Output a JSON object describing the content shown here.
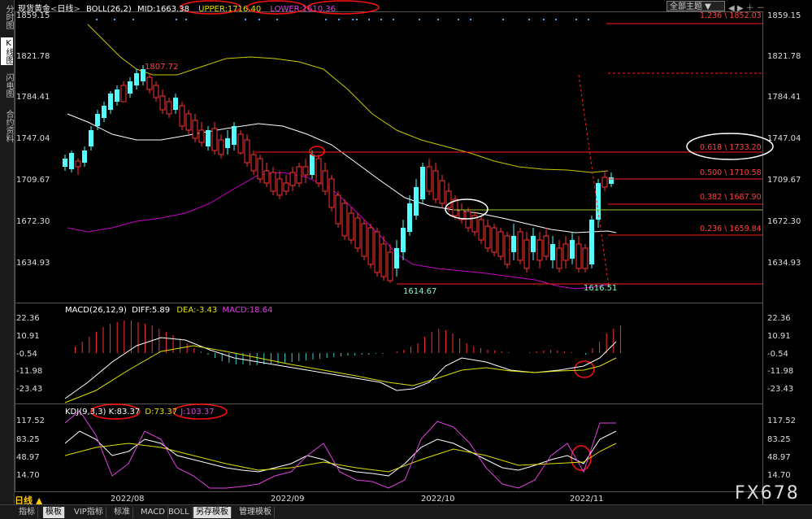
{
  "sidebar": {
    "tabs": [
      {
        "label": "分时图"
      },
      {
        "label": "K线图"
      },
      {
        "label": "闪电图"
      },
      {
        "label": "合约资料"
      }
    ]
  },
  "header": {
    "instrument": "现货黄金",
    "period": "日线",
    "boll_label": "BOLL(26,2)",
    "mid": "MID:1663.38",
    "upper": "UPPER:1716.40",
    "lower": "LOWER:1610.36",
    "theme_button": "全部主题"
  },
  "price_axis": [
    "1859.15",
    "1821.78",
    "1784.41",
    "1747.04",
    "1709.67",
    "1672.30",
    "1634.93"
  ],
  "annotations": {
    "high": "1807.72",
    "low1": "1614.67",
    "low2": "1616.51"
  },
  "fib_levels": [
    {
      "label": "1.236 \\ 1852.03"
    },
    {
      "label": "0.618 \\ 1733.20"
    },
    {
      "label": "0.500 \\ 1710.58"
    },
    {
      "label": "0.382 \\ 1687.90"
    },
    {
      "label": "0.236 \\ 1659.84"
    }
  ],
  "macd": {
    "label": "MACD(26,12,9)",
    "diff": "DIFF:5.89",
    "dea": "DEA:-3.43",
    "macd": "MACD:18.64",
    "axis": [
      "22.36",
      "10.91",
      "-0.54",
      "-11.98",
      "-23.43"
    ]
  },
  "kdj": {
    "label": "KDJ(9,3,3)",
    "k": "K:83.37",
    "d": "D:73.37",
    "j": "J:103.37",
    "axis": [
      "117.52",
      "83.25",
      "48.97",
      "14.70"
    ]
  },
  "date_axis": [
    "2022/08",
    "2022/09",
    "2022/10",
    "2022/11"
  ],
  "period_button": "日线 ▲",
  "bottom_tabs": [
    "指标",
    "模板",
    "VIP指标",
    "标准",
    "MACD",
    "BOLL",
    "另存模板",
    "管理模板"
  ],
  "watermark": "FX678",
  "colors": {
    "up": "#ff3232",
    "down": "#54ffff",
    "mid": "#ffffff",
    "upper": "#c8c800",
    "lower": "#c800c8",
    "fib": "#ff2020",
    "highlight": "#ff1010"
  }
}
